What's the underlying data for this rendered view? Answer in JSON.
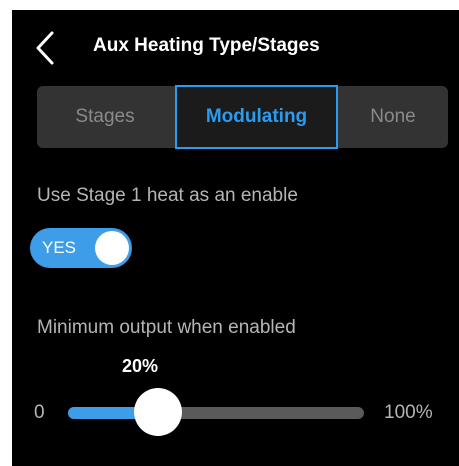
{
  "header": {
    "title": "Aux Heating Type/Stages",
    "back_icon": "chevron-left-icon"
  },
  "segments": [
    {
      "label": "Stages",
      "selected": false
    },
    {
      "label": "Modulating",
      "selected": true
    },
    {
      "label": "None",
      "selected": false
    }
  ],
  "enable_setting": {
    "label": "Use Stage 1 heat as an enable",
    "toggle_label": "YES",
    "toggle_on": true
  },
  "minimum_output": {
    "label": "Minimum output when enabled",
    "value_label": "20%",
    "value_percent": 20,
    "min_label": "0",
    "max_label": "100%"
  },
  "colors": {
    "accent": "#2b9bf0",
    "toggle_on": "#3d9de9",
    "background": "#000000",
    "segment_bg": "#333333",
    "track": "#5a5a5a"
  }
}
